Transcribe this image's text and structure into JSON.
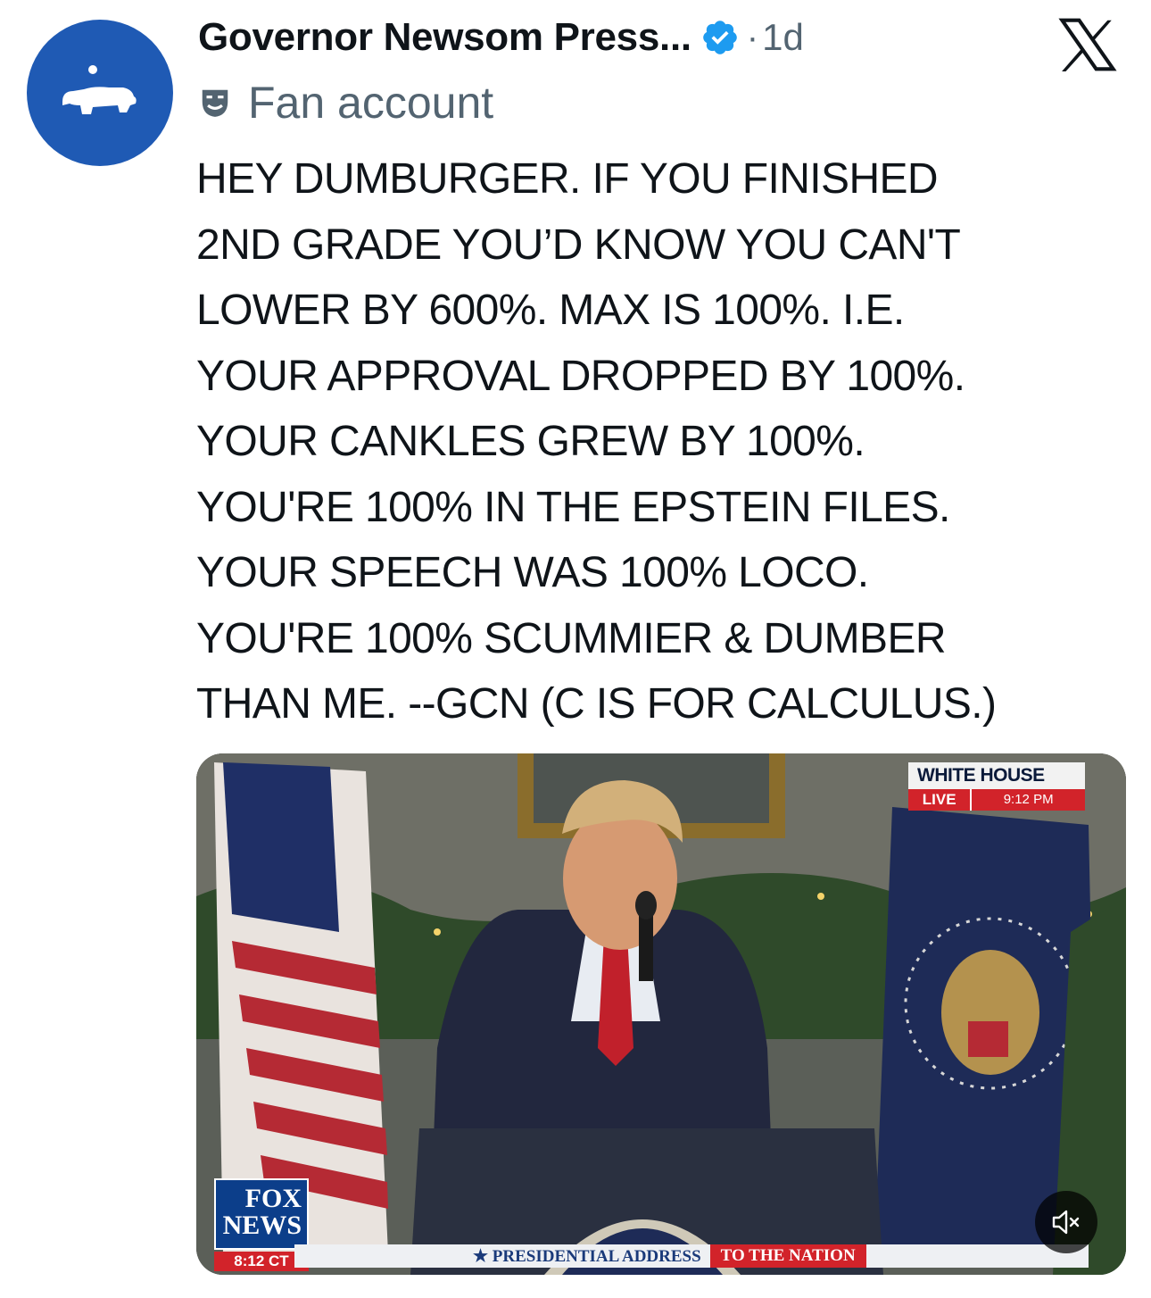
{
  "tweet": {
    "display_name": "Governor Newsom Press...",
    "time_separator": "·",
    "time": "1d",
    "label": "Fan account",
    "text_lines": [
      "HEY DUMBURGER. IF YOU FINISHED",
      "2ND GRADE YOU’D KNOW YOU CAN'T",
      "LOWER BY 600%. MAX IS 100%. I.E.",
      "YOUR APPROVAL DROPPED BY 100%.",
      "YOUR CANKLES GREW BY 100%.",
      "YOU'RE 100% IN THE EPSTEIN FILES.",
      "YOUR SPEECH WAS 100% LOCO.",
      "YOU'RE 100% SCUMMIER & DUMBER",
      "THAN ME. --GCN (C IS FOR CALCULUS.)"
    ],
    "icons": {
      "verified": "verified-badge-icon",
      "platform": "x-logo-icon",
      "fan_label": "theater-mask-icon"
    }
  },
  "media": {
    "broadcast_location": "WHITE HOUSE",
    "live_label": "LIVE",
    "broadcast_time": "9:12 PM",
    "network_logo_line1": "FOX",
    "network_logo_line2": "NEWS",
    "network_clock": "8:12 CT",
    "ticker_part1": "★ PRESIDENTIAL ADDRESS",
    "ticker_part2": "TO THE NATION",
    "mute_icon": "muted-speaker-icon"
  },
  "colors": {
    "avatar_bg": "#1f5ab4",
    "verified": "#1d9bf0",
    "secondary_text": "#536471",
    "fox_red": "#d2232a",
    "fox_blue": "#0c3e8a"
  }
}
